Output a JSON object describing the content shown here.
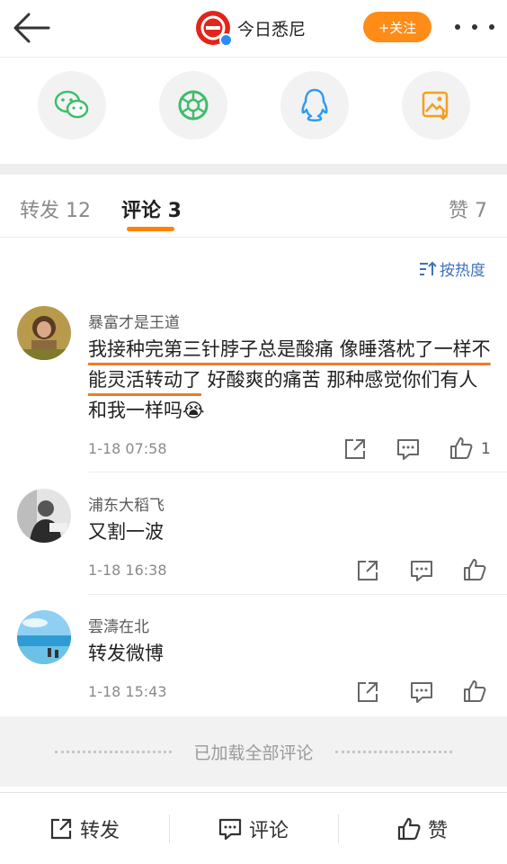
{
  "header": {
    "title": "今日悉尼",
    "follow_label": "+关注"
  },
  "share": [
    "wechat-icon",
    "moments-icon",
    "qq-icon",
    "save-image-icon"
  ],
  "tabs": {
    "repost": "转发 12",
    "comment": "评论 3",
    "like": "赞 7"
  },
  "sort_label": "按热度",
  "comments": [
    {
      "name": "暴富才是王道",
      "text_underlined_1": "我接种完第三针脖子总是酸痛 像睡落枕了",
      "text_underlined_2": "一样不能灵活转动了",
      "text_rest": " 好酸爽的痛苦 那种感觉你们有人和我一样吗😭",
      "time": "1-18 07:58",
      "likes": "1"
    },
    {
      "name": "浦东大稻飞",
      "text": "又割一波",
      "time": "1-18 16:38"
    },
    {
      "name": "雲濤在北",
      "text": "转发微博",
      "time": "1-18 15:43"
    }
  ],
  "loaded_text": "已加载全部评论",
  "bottom_bar": {
    "repost": "转发",
    "comment": "评论",
    "like": "赞"
  },
  "colors": {
    "accent": "#ff8200",
    "link": "#3f73b8",
    "underline": "#f07a2e"
  }
}
